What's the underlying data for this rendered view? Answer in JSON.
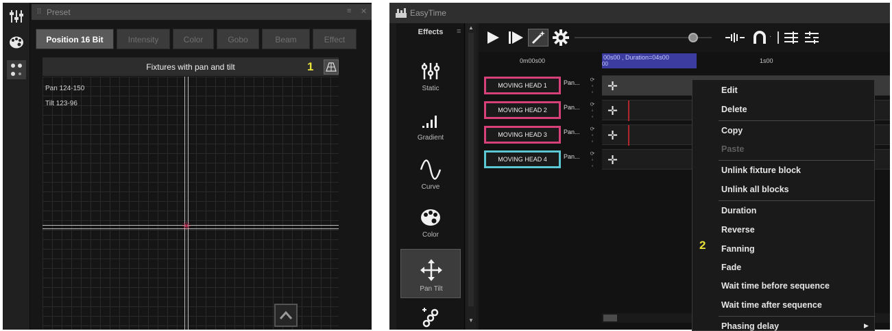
{
  "left_panel": {
    "window_title": "Preset",
    "tabs": [
      "Position 16 Bit",
      "Intensity",
      "Color",
      "Gobo",
      "Beam",
      "Effect"
    ],
    "grid": {
      "title": "Fixtures with pan and tilt",
      "marker": "1",
      "pan_readout": "Pan 124-150",
      "tilt_readout": "Tilt 123-96"
    }
  },
  "right_panel": {
    "window_title": "EasyTime",
    "effects_header": "Effects",
    "effects": [
      {
        "label": "Static",
        "icon": "sliders-icon"
      },
      {
        "label": "Gradient",
        "icon": "gradient-bars-icon"
      },
      {
        "label": "Curve",
        "icon": "sine-curve-icon"
      },
      {
        "label": "Color",
        "icon": "palette-icon"
      },
      {
        "label": "Pan Tilt",
        "icon": "pan-tilt-arrows-icon",
        "active": true
      },
      {
        "label": "",
        "icon": "chain-icon"
      }
    ],
    "ruler": {
      "start": "0m00s00",
      "selection": "00s00 , Duration=04s00",
      "selection_sub": "00",
      "one_second": "1s00"
    },
    "tracks": [
      {
        "name": "MOVING HEAD  1",
        "attr": "Pan...",
        "color": "#d8407a"
      },
      {
        "name": "MOVING HEAD  2",
        "attr": "Pan...",
        "color": "#d8407a"
      },
      {
        "name": "MOVING HEAD  3",
        "attr": "Pan...",
        "color": "#d8407a"
      },
      {
        "name": "MOVING HEAD  4",
        "attr": "Pan...",
        "color": "#5bc8d3"
      }
    ],
    "context_menu": {
      "marker": "2",
      "items": [
        {
          "label": "Edit"
        },
        {
          "label": "Delete"
        },
        {
          "label": "Copy"
        },
        {
          "label": "Paste",
          "disabled": true
        },
        {
          "label": "Unlink fixture block"
        },
        {
          "label": "Unlink all blocks"
        },
        {
          "label": "Duration"
        },
        {
          "label": "Reverse"
        },
        {
          "label": "Fanning"
        },
        {
          "label": "Fade"
        },
        {
          "label": "Wait time before sequence"
        },
        {
          "label": "Wait time after sequence"
        },
        {
          "label": "Phasing delay",
          "submenu": true
        }
      ]
    }
  }
}
